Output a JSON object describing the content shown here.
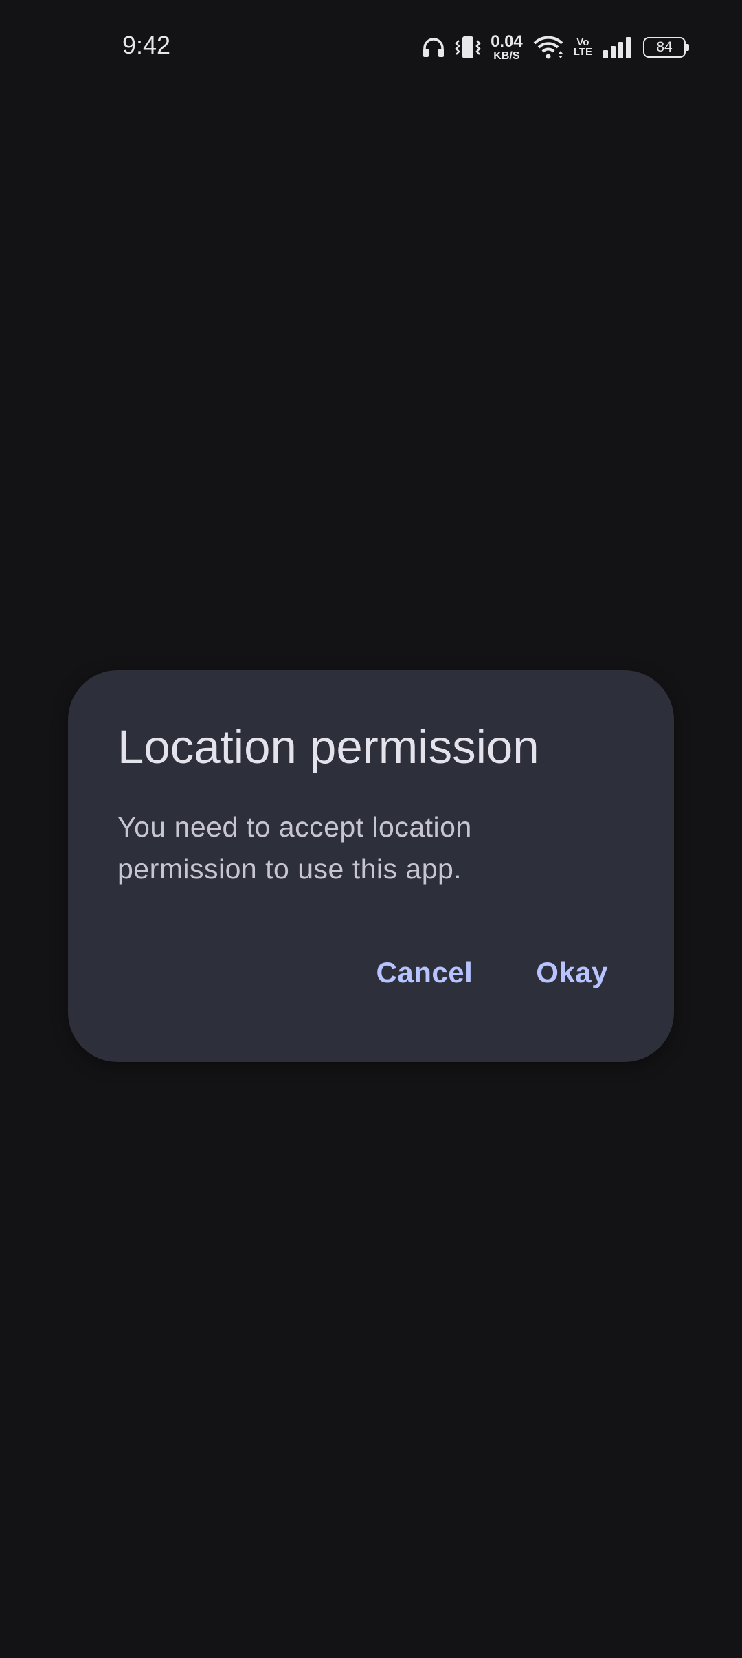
{
  "status_bar": {
    "time": "9:42",
    "net_speed_value": "0.04",
    "net_speed_unit": "KB/S",
    "volte_top": "Vo",
    "volte_bottom": "LTE",
    "battery_level": "84",
    "icons": [
      "headphones-icon",
      "vibrate-icon",
      "wifi-icon",
      "volte-icon",
      "signal-icon",
      "battery-icon"
    ]
  },
  "dialog": {
    "title": "Location permission",
    "message": "You need to accept location permission to use this app.",
    "cancel_label": "Cancel",
    "ok_label": "Okay"
  },
  "colors": {
    "background": "#131315",
    "dialog_surface": "#2d2f3a",
    "accent": "#b7c4ff",
    "title_text": "#e4e2ea",
    "body_text": "#c7c6d0"
  }
}
